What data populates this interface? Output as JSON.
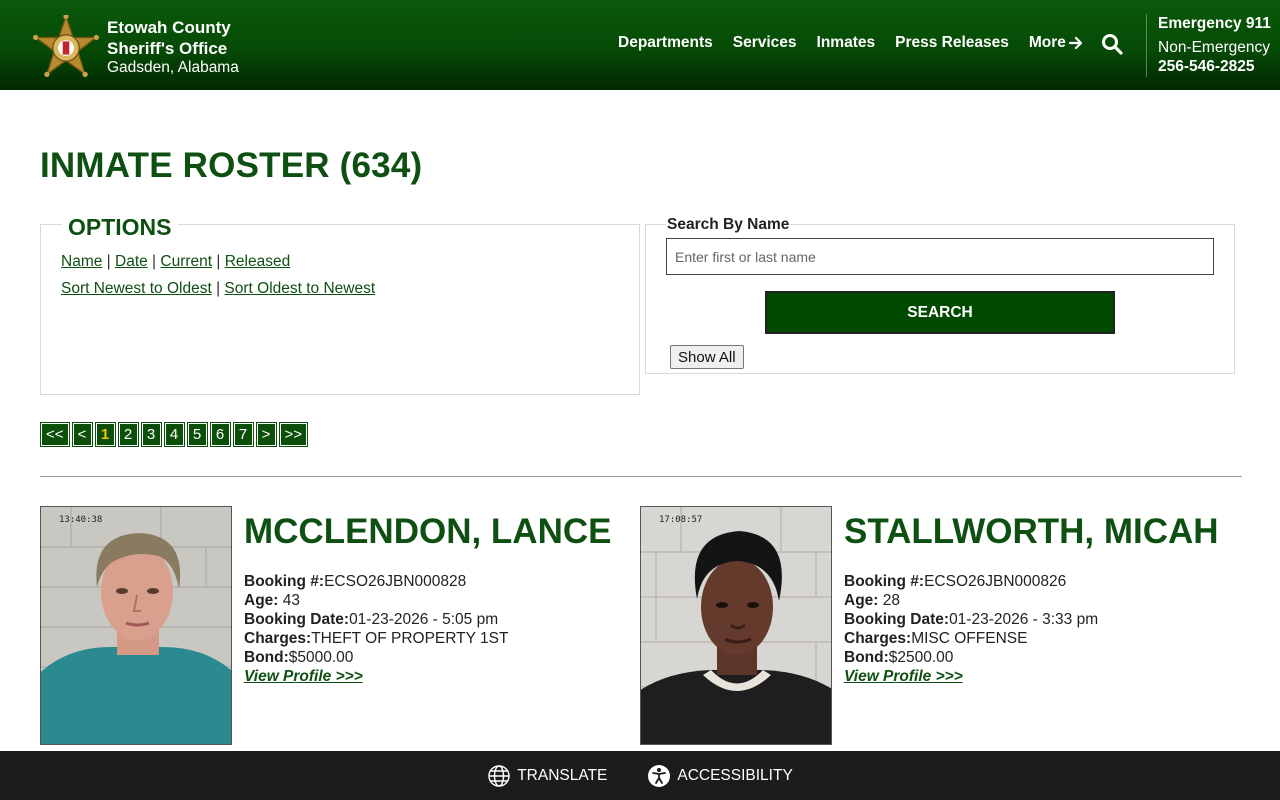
{
  "header": {
    "org_line1": "Etowah County",
    "org_line2": "Sheriff's Office",
    "location": "Gadsden, Alabama",
    "nav": [
      "Departments",
      "Services",
      "Inmates",
      "Press Releases"
    ],
    "more_label": "More",
    "emergency": "Emergency 911",
    "non_emergency_label": "Non-Emergency",
    "non_emergency_phone": "256-546-2825"
  },
  "page_title": "INMATE ROSTER (634)",
  "options": {
    "title": "OPTIONS",
    "sort_links": [
      "Name",
      "Date",
      "Current",
      "Released"
    ],
    "order_links": [
      "Sort Newest to Oldest",
      "Sort Oldest to Newest"
    ]
  },
  "search": {
    "label": "Search By Name",
    "placeholder": "Enter first or last name",
    "button": "SEARCH",
    "show_all": "Show All"
  },
  "pagination": {
    "first": "<<",
    "prev": "<",
    "pages": [
      "1",
      "2",
      "3",
      "4",
      "5",
      "6",
      "7"
    ],
    "current": "1",
    "next": ">",
    "last": ">>"
  },
  "inmates": [
    {
      "name": "MCCLENDON, LANCE",
      "booking_label": "Booking #:",
      "booking_number": "ECSO26JBN000828",
      "age_label": "Age:",
      "age": "43",
      "booking_date_label": "Booking Date:",
      "booking_date": "01-23-2026 - 5:05 pm",
      "charges_label": "Charges:",
      "charges": "THEFT OF PROPERTY 1ST",
      "bond_label": "Bond:",
      "bond": "$5000.00",
      "profile_link": "View Profile >>>",
      "photo_timestamp": "13:40:38"
    },
    {
      "name": "STALLWORTH, MICAH",
      "booking_label": "Booking #:",
      "booking_number": "ECSO26JBN000826",
      "age_label": "Age:",
      "age": "28",
      "booking_date_label": "Booking Date:",
      "booking_date": "01-23-2026 - 3:33 pm",
      "charges_label": "Charges:",
      "charges": "MISC OFFENSE",
      "bond_label": "Bond:",
      "bond": "$2500.00",
      "profile_link": "View Profile >>>",
      "photo_timestamp": "17:08:57"
    }
  ],
  "footer": {
    "translate": "TRANSLATE",
    "accessibility": "ACCESSIBILITY"
  },
  "colors": {
    "brand_green": "#0e4f12",
    "header_green": "#064a06",
    "footer_dark": "#1c1c1c",
    "current_page": "#f0c400"
  }
}
